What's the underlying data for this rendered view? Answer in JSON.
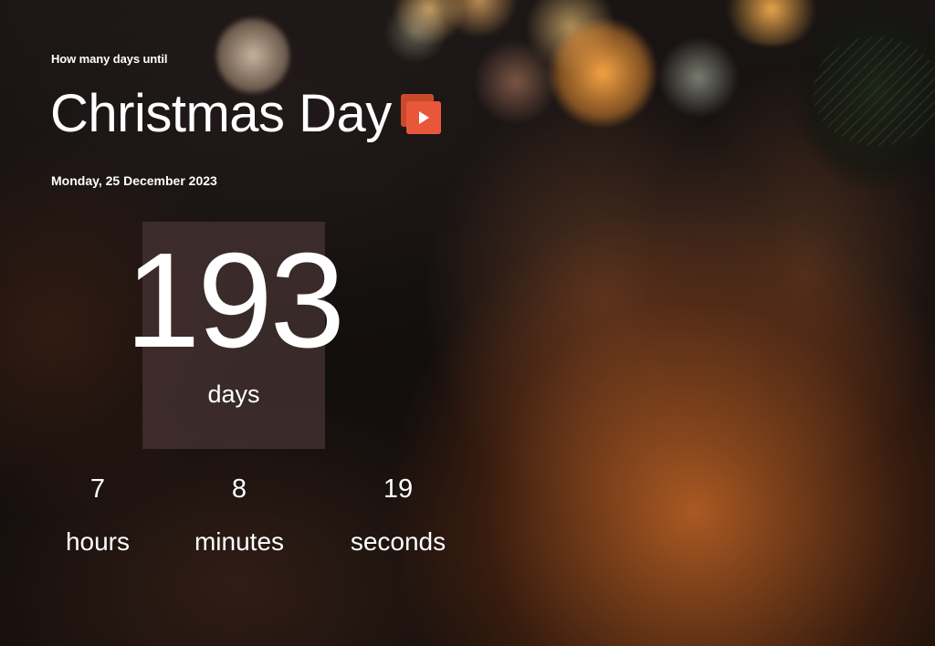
{
  "header": {
    "eyebrow": "How many days until",
    "title": "Christmas Day",
    "date": "Monday, 25 December 2023",
    "play_icon": "play-icon"
  },
  "countdown": {
    "days": {
      "value": "193",
      "label": "days"
    },
    "hours": {
      "value": "7",
      "label": "hours"
    },
    "minutes": {
      "value": "8",
      "label": "minutes"
    },
    "seconds": {
      "value": "19",
      "label": "seconds"
    }
  },
  "colors": {
    "accent": "#e8573a",
    "days_box": "#483434",
    "text": "#ffffff"
  }
}
